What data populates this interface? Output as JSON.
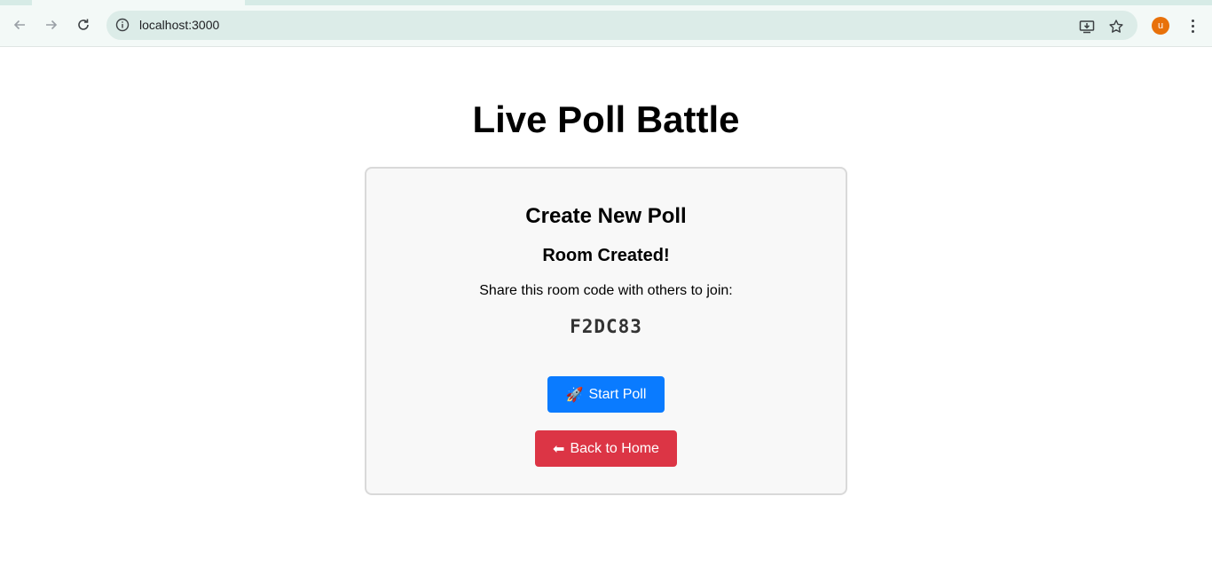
{
  "browser": {
    "url": "localhost:3000",
    "avatar_letter": "u",
    "icons": {
      "back": "arrow-left-icon",
      "forward": "arrow-right-icon",
      "reload": "reload-icon",
      "site_info": "info-icon",
      "install": "install-app-icon",
      "bookmark": "star-icon",
      "menu": "kebab-menu-icon"
    }
  },
  "page": {
    "title": "Live Poll Battle",
    "card": {
      "title": "Create New Poll",
      "status": "Room Created!",
      "share_text": "Share this room code with others to join:",
      "room_code": "F2DC83",
      "start_button": {
        "icon": "🚀",
        "label": "Start Poll",
        "color": "#0a7bff"
      },
      "back_button": {
        "icon": "⬅",
        "label": "Back to Home",
        "color": "#dc3545"
      }
    }
  }
}
